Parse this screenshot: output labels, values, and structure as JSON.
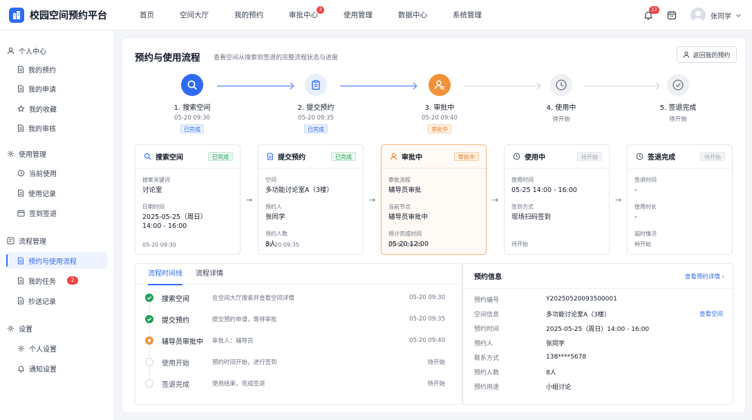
{
  "app": {
    "title": "校园空间预约平台"
  },
  "nav": [
    {
      "label": "首页"
    },
    {
      "label": "空间大厅"
    },
    {
      "label": "我的预约"
    },
    {
      "label": "审批中心",
      "badge": "3"
    },
    {
      "label": "使用管理"
    },
    {
      "label": "数据中心"
    },
    {
      "label": "系统管理"
    }
  ],
  "header": {
    "notification_count": "12",
    "username": "张同学"
  },
  "sidebar": {
    "groups": [
      {
        "label": "个人中心",
        "icon": "user-icon",
        "items": [
          {
            "label": "我的预约",
            "icon": "document-icon"
          },
          {
            "label": "我的申请",
            "icon": "document-icon"
          },
          {
            "label": "我的收藏",
            "icon": "star-icon"
          },
          {
            "label": "我的审核",
            "icon": "document-icon"
          }
        ]
      },
      {
        "label": "使用管理",
        "icon": "gear-icon",
        "items": [
          {
            "label": "当前使用",
            "icon": "clock-icon"
          },
          {
            "label": "使用记录",
            "icon": "document-icon"
          },
          {
            "label": "签到签退",
            "icon": "calendar-icon"
          }
        ]
      },
      {
        "label": "流程管理",
        "icon": "flow-icon",
        "items": [
          {
            "label": "预约与使用流程",
            "icon": "document-icon",
            "active": true
          },
          {
            "label": "我的任务",
            "icon": "document-icon",
            "badge": "2"
          },
          {
            "label": "抄送记录",
            "icon": "document-icon"
          }
        ]
      },
      {
        "label": "设置",
        "icon": "gear-icon",
        "items": [
          {
            "label": "个人设置",
            "icon": "gear-icon"
          },
          {
            "label": "通知设置",
            "icon": "bell-icon"
          }
        ]
      }
    ]
  },
  "page": {
    "title": "预约与使用流程",
    "subtitle": "查看空间从搜索到签退的完整流程状态与进度",
    "back_button": "返回我的预约"
  },
  "steps": [
    {
      "label": "1. 搜索空间",
      "time": "05-20 09:30",
      "badge": "已完成",
      "status": "done",
      "icon": "search-icon"
    },
    {
      "label": "2. 提交预约",
      "time": "05-20 09:35",
      "badge": "已完成",
      "status": "done",
      "icon": "clipboard-icon"
    },
    {
      "label": "3. 审批中",
      "time": "05-20 09:40",
      "badge": "审批中",
      "status": "active",
      "icon": "user-check-icon"
    },
    {
      "label": "4. 使用中",
      "time": "待开始",
      "status": "waiting",
      "icon": "clock-icon"
    },
    {
      "label": "5. 签退完成",
      "time": "待开始",
      "status": "waiting",
      "icon": "check-circle-icon"
    }
  ],
  "cards": [
    {
      "title": "搜索空间",
      "tag": "已完成",
      "icon": "search-icon",
      "fields": [
        {
          "label": "搜索关键词",
          "value": "讨论室"
        },
        {
          "label": "日期时间",
          "value": "2025-05-25（周日）",
          "value2": "14:00 - 16:00"
        }
      ],
      "footer": "05-20 09:30"
    },
    {
      "title": "提交预约",
      "tag": "已完成",
      "icon": "document-icon",
      "fields": [
        {
          "label": "空间",
          "value": "多功能讨论室A（3楼）"
        },
        {
          "label": "预约人",
          "value": "张同学"
        },
        {
          "label": "预约人数",
          "value": "8人"
        }
      ],
      "footer": "05-20 09:35"
    },
    {
      "title": "审批中",
      "tag": "审批中",
      "icon": "user-icon",
      "fields": [
        {
          "label": "审批流程",
          "value": "辅导员审批"
        },
        {
          "label": "当前节点",
          "value": "辅导员审批中"
        },
        {
          "label": "预计完成时间",
          "value": "05-20 12:00"
        }
      ],
      "footer": "05-20 09:40"
    },
    {
      "title": "使用中",
      "tag": "待开始",
      "icon": "clock-icon",
      "fields": [
        {
          "label": "使用时间",
          "value": "05-25 14:00 - 16:00"
        },
        {
          "label": "签到方式",
          "value": "现场扫码签到"
        }
      ],
      "footer": "待开始"
    },
    {
      "title": "签退完成",
      "tag": "待开始",
      "icon": "clock-icon",
      "fields": [
        {
          "label": "签退时间",
          "value": "-"
        },
        {
          "label": "使用时长",
          "value": "-"
        },
        {
          "label": "超时情况",
          "value": "-"
        }
      ],
      "footer": "待开始"
    }
  ],
  "timeline": {
    "tabs": [
      "流程时间线",
      "流程详情"
    ],
    "rows": [
      {
        "name": "搜索空间",
        "desc": "在空间大厅搜索并查看空间详情",
        "time": "05-20 09:30",
        "status": "done"
      },
      {
        "name": "提交预约",
        "desc": "提交预约申请，等待审批",
        "time": "05-20 09:35",
        "status": "done"
      },
      {
        "name": "辅导员审批中",
        "desc": "审批人：辅导员",
        "time": "05-20 09:40",
        "status": "active"
      },
      {
        "name": "使用开始",
        "desc": "预约时间开始，进行签到",
        "time": "待开始",
        "status": "waiting"
      },
      {
        "name": "签退完成",
        "desc": "使用结束，完成签退",
        "time": "待开始",
        "status": "waiting"
      }
    ]
  },
  "booking_info": {
    "title": "预约信息",
    "detail_link": "查看预约详情",
    "rows": [
      {
        "label": "预约编号",
        "value": "Y20250520093500001"
      },
      {
        "label": "空间信息",
        "value": "多功能讨论室A（3楼）",
        "link": "查看空间"
      },
      {
        "label": "预约时间",
        "value": "2025-05-25（周日）14:00 - 16:00"
      },
      {
        "label": "预约人",
        "value": "张同学"
      },
      {
        "label": "联系方式",
        "value": "138****5678"
      },
      {
        "label": "预约人数",
        "value": "8人"
      },
      {
        "label": "预约用途",
        "value": "小组讨论"
      }
    ]
  },
  "colors": {
    "primary": "#2f6bf2",
    "active": "#f0923a",
    "success": "#22a05a",
    "danger": "#ef4444"
  }
}
